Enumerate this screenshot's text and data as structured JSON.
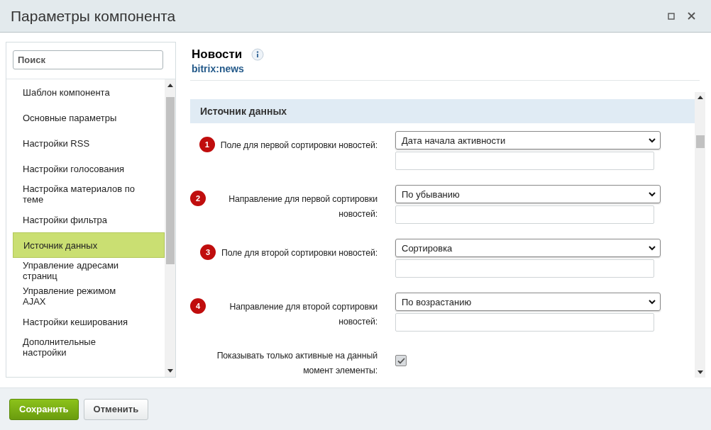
{
  "window": {
    "title": "Параметры компонента"
  },
  "sidebar": {
    "search": {
      "placeholder": "Поиск"
    },
    "items": [
      {
        "label": "Шаблон компонента",
        "selected": false
      },
      {
        "label": "Основные параметры",
        "selected": false
      },
      {
        "label": "Настройки RSS",
        "selected": false
      },
      {
        "label": "Настройки голосования",
        "selected": false
      },
      {
        "label": "Настройка материалов по теме",
        "selected": false
      },
      {
        "label": "Настройки фильтра",
        "selected": false
      },
      {
        "label": "Источник данных",
        "selected": true
      },
      {
        "label": "Управление адресами страниц",
        "selected": false
      },
      {
        "label": "Управление режимом AJAX",
        "selected": false
      },
      {
        "label": "Настройки кеширования",
        "selected": false
      },
      {
        "label": "Дополнительные настройки",
        "selected": false
      }
    ]
  },
  "component": {
    "title": "Новости",
    "code": "bitrix:news"
  },
  "section": {
    "title": "Источник данных"
  },
  "fields": [
    {
      "kind": "select",
      "badge": "1",
      "label": "Поле для первой сортировки новостей:",
      "value": "Дата начала активности"
    },
    {
      "kind": "select",
      "badge": "2",
      "label": "Направление для первой сортировки новостей:",
      "value": "По убыванию"
    },
    {
      "kind": "select",
      "badge": "3",
      "label": "Поле для второй сортировки новостей:",
      "value": "Сортировка"
    },
    {
      "kind": "select",
      "badge": "4",
      "label": "Направление для второй сортировки новостей:",
      "value": "По возрастанию"
    },
    {
      "kind": "checkbox",
      "label": "Показывать только активные на данный момент элементы:",
      "checked": true
    }
  ],
  "buttons": [
    {
      "kind": "primary",
      "label": "Сохранить"
    },
    {
      "kind": "secondary",
      "label": "Отменить"
    }
  ]
}
